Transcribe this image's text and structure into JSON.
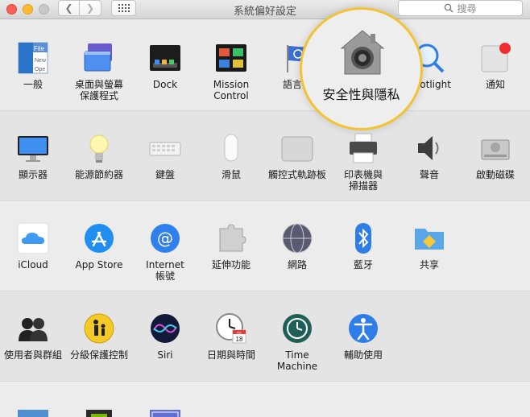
{
  "window": {
    "title": "系統偏好設定"
  },
  "search": {
    "placeholder": "搜尋"
  },
  "highlight": {
    "label": "安全性與隱私"
  },
  "sections": {
    "personal": {
      "general": "一般",
      "desktop": "桌面與螢幕\n保護程式",
      "dock": "Dock",
      "mission": "Mission\nControl",
      "language": "語言與",
      "spotlight": "Spotlight",
      "notifications": "通知"
    },
    "hardware": {
      "displays": "顯示器",
      "energy": "能源節約器",
      "keyboard": "鍵盤",
      "mouse": "滑鼠",
      "trackpad": "觸控式軌跡板",
      "printers": "印表機與\n掃描器",
      "sound": "聲音",
      "startup": "啟動磁碟"
    },
    "internet": {
      "icloud": "iCloud",
      "appstore": "App Store",
      "accounts": "Internet\n帳號",
      "extensions": "延伸功能",
      "network": "網路",
      "bluetooth": "藍牙",
      "sharing": "共享"
    },
    "system": {
      "users": "使用者與群組",
      "parental": "分級保護控制",
      "siri": "Siri",
      "datetime": "日期與時間",
      "timemachine": "Time Machine",
      "accessibility": "輔助使用"
    }
  },
  "calendar_icon": {
    "month": "JUL",
    "day": "18"
  },
  "general_icon": {
    "word1": "File",
    "word2": "New",
    "word3": "Ope"
  },
  "colors": {
    "accent": "#f2c333",
    "close": "#fc5f57",
    "minimize": "#fdbc2e"
  }
}
